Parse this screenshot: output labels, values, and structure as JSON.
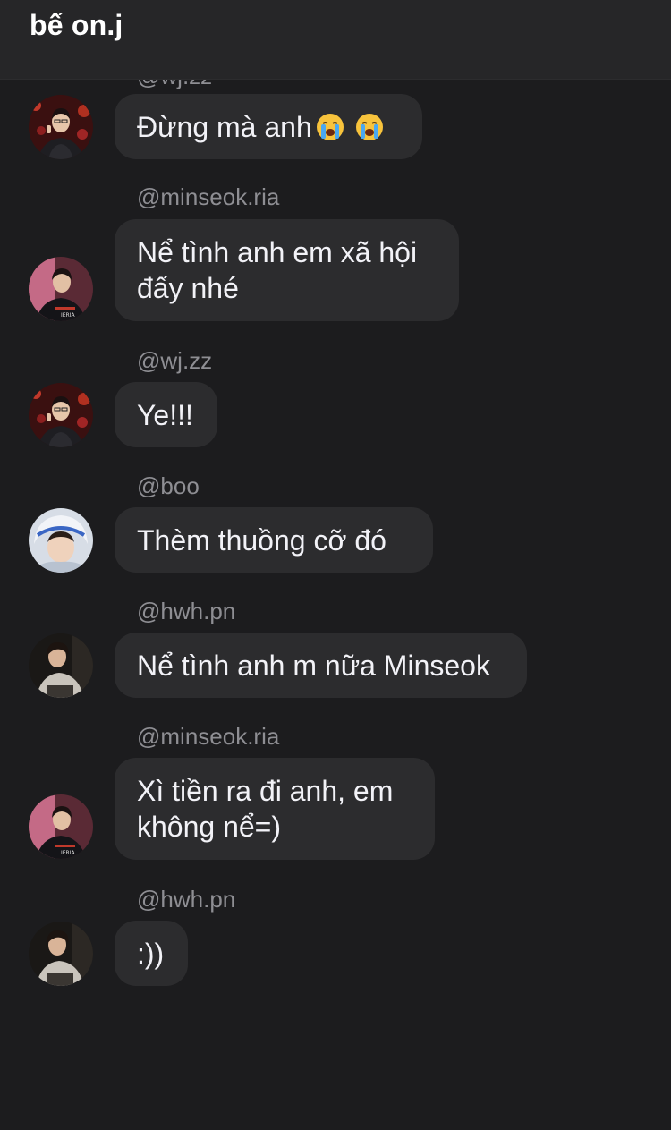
{
  "header": {
    "title": "bế on.j"
  },
  "clipped_username": "@wj.zz",
  "messages": [
    {
      "username": "",
      "text": "Đừng mà anh",
      "emoji_count": 2,
      "emoji": "loudly-crying-face",
      "avatar": "wj-zz"
    },
    {
      "username": "@minseok.ria",
      "text": "Nể tình anh em xã hội đấy nhé",
      "avatar": "minseok-ria"
    },
    {
      "username": "@wj.zz",
      "text": "Ye!!!",
      "avatar": "wj-zz"
    },
    {
      "username": "@boo",
      "text": "Thèm thuồng cỡ đó",
      "avatar": "boo"
    },
    {
      "username": "@hwh.pn",
      "text": "Nể tình anh m nữa Minseok",
      "avatar": "hwh-pn"
    },
    {
      "username": "@minseok.ria",
      "text": "Xì tiền ra đi anh, em không nể=)",
      "avatar": "minseok-ria"
    },
    {
      "username": "@hwh.pn",
      "text": ":))",
      "avatar": "hwh-pn"
    }
  ]
}
